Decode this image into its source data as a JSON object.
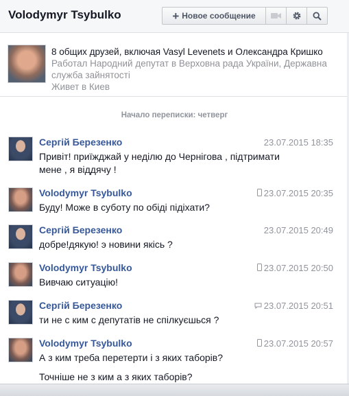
{
  "header": {
    "title": "Volodymyr Tsybulko",
    "new_message_label": "Новое сообщение",
    "icons": [
      "video-icon",
      "gear-icon",
      "search-icon"
    ]
  },
  "profile": {
    "friends_line": "8 общих друзей, включая Vasyl Levenets и Олександра Кришко",
    "work_line": "Работал Народний депутат в Верховна рада України, Державна служба зайнятості",
    "city_line": "Живет в Киев"
  },
  "separator": "Начало переписки: четверг",
  "messages": [
    {
      "author": "Сергій Березенко",
      "time": "23.07.2015 18:35",
      "device": "",
      "text": "Привіт! приїжджай у неділю до Чернігова , підтримати мене , я віддячу !"
    },
    {
      "author": "Volodymyr Tsybulko",
      "time": "23.07.2015 20:35",
      "device": "phone-icon",
      "text": "Буду! Може в суботу по обіді підіхати?"
    },
    {
      "author": "Сергій Березенко",
      "time": "23.07.2015 20:49",
      "device": "",
      "text": "добре!дякую! э новини якісь ?"
    },
    {
      "author": "Volodymyr Tsybulko",
      "time": "23.07.2015 20:50",
      "device": "phone-icon",
      "text": "Вивчаю ситуацію!"
    },
    {
      "author": "Сергій Березенко",
      "time": "23.07.2015 20:51",
      "device": "chat-icon",
      "text": "ти не с ким с депутатів не спілкуєшься ?"
    },
    {
      "author": "Volodymyr Tsybulko",
      "time": "23.07.2015 20:57",
      "device": "phone-icon",
      "text": "А з ким треба перетерти і з яких таборів?"
    }
  ],
  "extra_line": "Точніше не з ким а з яких таборів?",
  "colors": {
    "author": "#365899",
    "meta": "#90949c",
    "text": "#141823"
  }
}
